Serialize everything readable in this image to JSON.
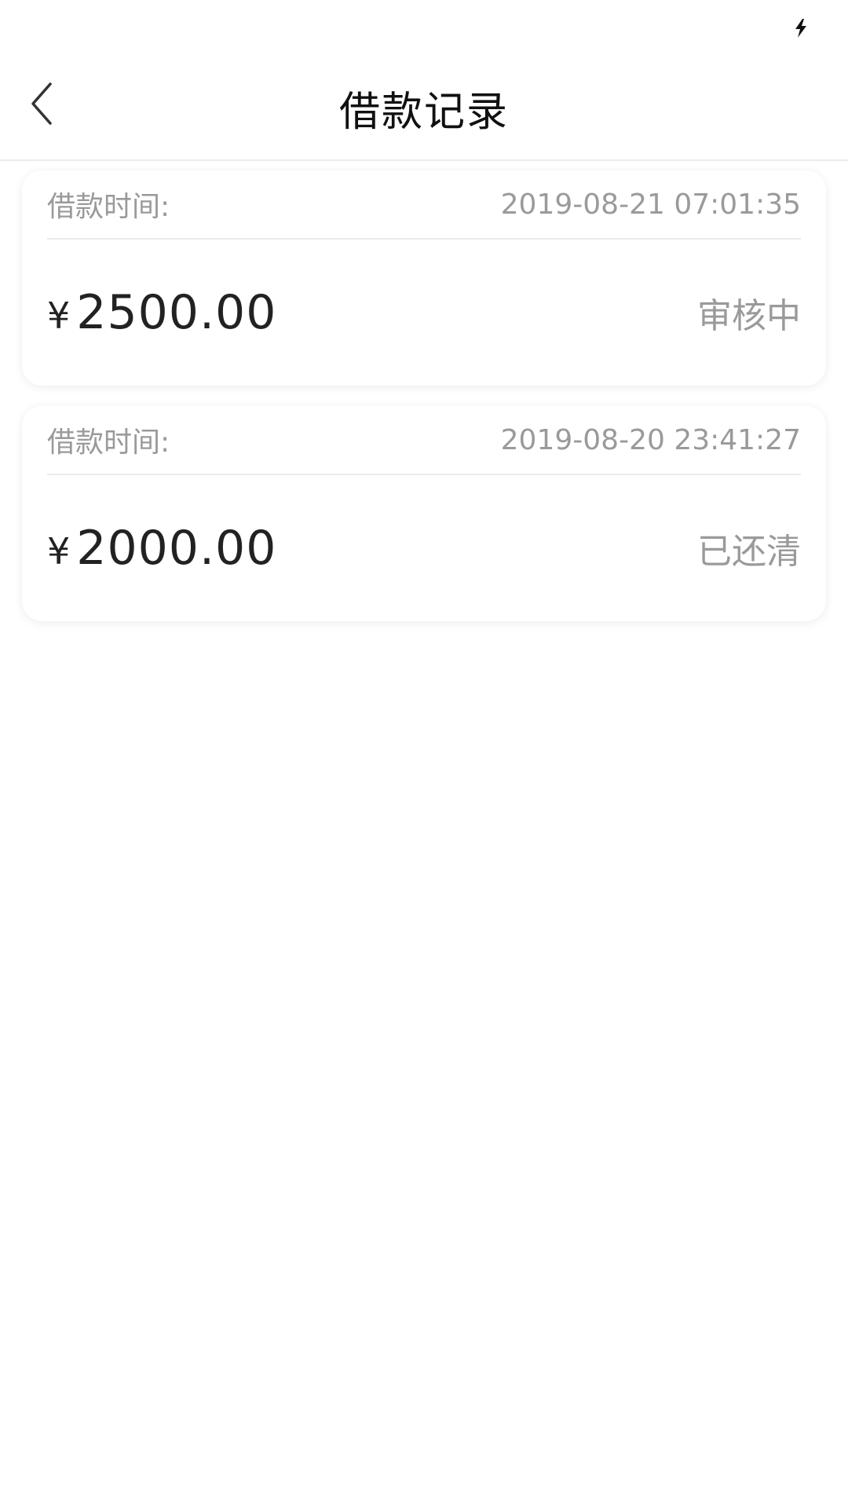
{
  "header": {
    "title": "借款记录"
  },
  "records": [
    {
      "time_label": "借款时间:",
      "time": "2019-08-21 07:01:35",
      "currency": "¥",
      "amount": "2500.00",
      "status": "审核中"
    },
    {
      "time_label": "借款时间:",
      "time": "2019-08-20 23:41:27",
      "currency": "¥",
      "amount": "2000.00",
      "status": "已还清"
    }
  ],
  "icons": {
    "back": "chevron-left-icon",
    "status_bar": "charging-icon"
  }
}
